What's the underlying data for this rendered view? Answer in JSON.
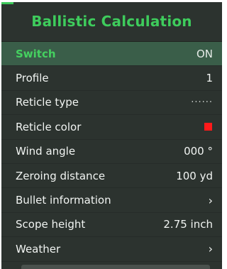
{
  "panel": {
    "title": "Ballistic Calculation"
  },
  "rows": [
    {
      "label": "Switch",
      "value": "ON",
      "selected": true
    },
    {
      "label": "Profile",
      "value": "1"
    },
    {
      "label": "Reticle type",
      "value": "······"
    },
    {
      "label": "Reticle color",
      "value_color": "#ff1a1a",
      "icon": "red-square-swatch"
    },
    {
      "label": "Wind angle",
      "value": "000 °"
    },
    {
      "label": "Zeroing distance",
      "value": "100  yd"
    },
    {
      "label": "Bullet information",
      "icon": "chevron-right-icon",
      "value": "›"
    },
    {
      "label": "Scope height",
      "value": "2.75 inch"
    },
    {
      "label": "Weather",
      "icon": "chevron-right-icon",
      "value": "›"
    }
  ],
  "colors": {
    "accent": "#3ecc5c",
    "selected_bg": "#3a5e49",
    "panel_bg": "#2c332f"
  }
}
